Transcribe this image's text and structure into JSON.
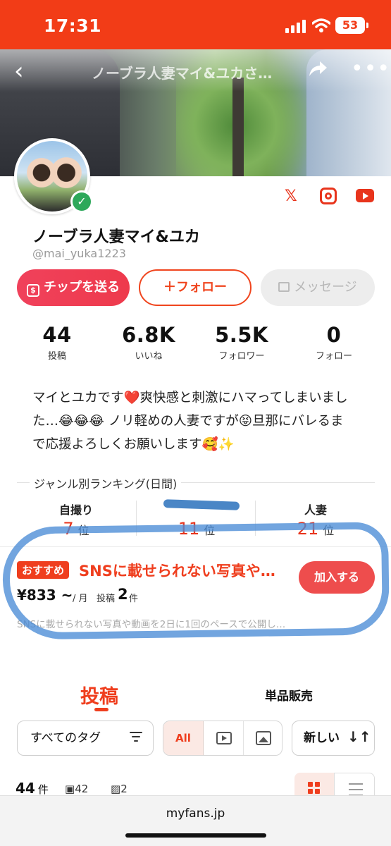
{
  "status_bar": {
    "time": "17:31",
    "battery": "53"
  },
  "nav": {
    "back_icon": "chevron-left-icon",
    "title": "ノーブラ人妻マイ&ユカさ…",
    "share_icon": "share-icon",
    "more_icon": "more-icon"
  },
  "profile": {
    "name": "ノーブラ人妻マイ&ユカ",
    "handle": "@mai_yuka1223",
    "verified": true,
    "social": [
      "x-icon",
      "instagram-icon",
      "youtube-icon"
    ]
  },
  "actions": {
    "tip": "チップを送る",
    "follow": "＋フォロー",
    "message": "メッセージ"
  },
  "stats": [
    {
      "value": "44",
      "label": "投稿"
    },
    {
      "value": "6.8K",
      "label": "いいね"
    },
    {
      "value": "5.5K",
      "label": "フォロワー"
    },
    {
      "value": "0",
      "label": "フォロー"
    }
  ],
  "bio": {
    "line1": "マイとユカです❤️爽快感と刺激にハマってしまいまし",
    "line2": "た…😂😂😂 ノリ軽めの人妻ですが😝旦那にバレるま",
    "line3": "で応援よろしくお願いします🥰✨"
  },
  "ranking": {
    "title": "ジャンル別ランキング(日間)",
    "items": [
      {
        "genre": "自撮り",
        "rank": "7",
        "suffix": "位"
      },
      {
        "genre": "",
        "rank": "11",
        "suffix": "位"
      },
      {
        "genre": "人妻",
        "rank": "21",
        "suffix": "位"
      }
    ]
  },
  "plan": {
    "badge": "おすすめ",
    "title": "SNSに載せられない写真や…",
    "price": "¥833 ~",
    "unit": "/ 月",
    "posts_label": "投稿",
    "posts_value": "2",
    "posts_unit": "件",
    "join": "加入する",
    "description": "SNSに載せられない写真や動画を2日に1回のペースで公開し…"
  },
  "tabs": {
    "posts": "投稿",
    "items": "単品販売"
  },
  "filters": {
    "tag": "すべてのタグ",
    "type_all": "All",
    "sort": "新しい",
    "sort_icon": "sort-icon"
  },
  "counts": {
    "total": "44",
    "total_unit": "件",
    "videos": "42",
    "images": "2"
  },
  "browser": {
    "url": "myfans.jp"
  },
  "colors": {
    "accent": "#ef3e1e",
    "status_bar": "#f23c17",
    "verified": "#2da85a",
    "annotation": "#4a8cd6"
  }
}
